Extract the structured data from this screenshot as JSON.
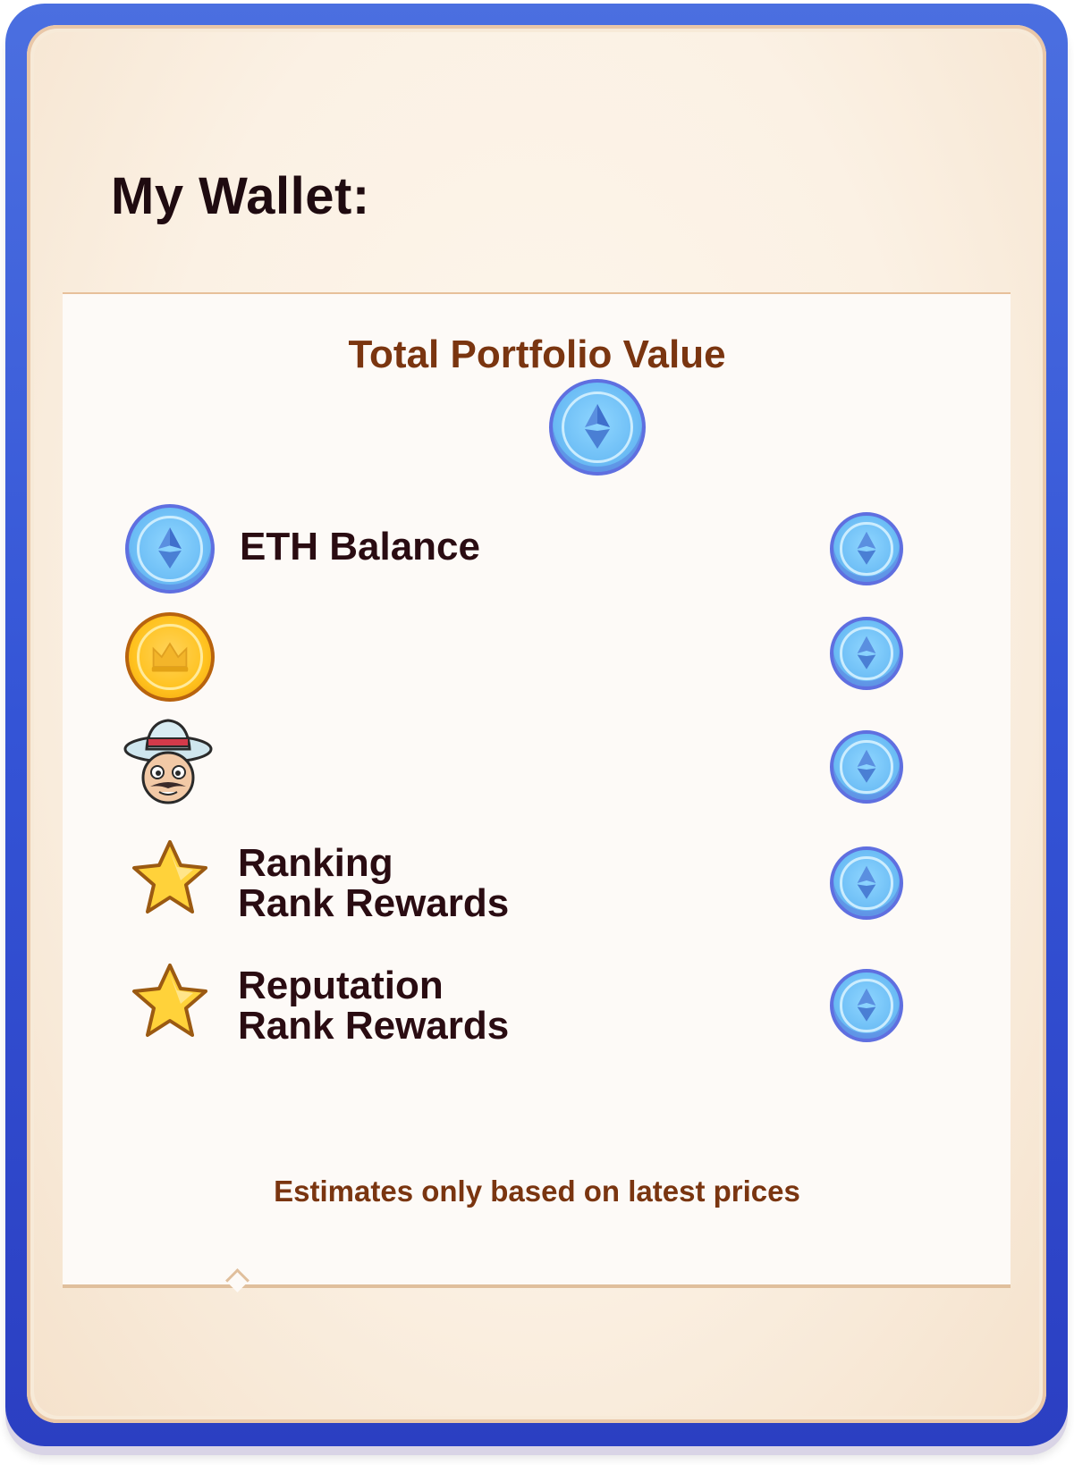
{
  "wallet": {
    "title": "My Wallet:",
    "portfolio_heading": "Total Portfolio Value",
    "portfolio_icon": "eth-coin-icon",
    "rows": [
      {
        "icon": "eth-coin-icon",
        "label": "ETH Balance",
        "value_icon": "eth-coin-icon"
      },
      {
        "icon": "gold-crown-coin-icon",
        "label": "",
        "value_icon": "eth-coin-icon"
      },
      {
        "icon": "character-avatar-icon",
        "label": "",
        "value_icon": "eth-coin-icon"
      },
      {
        "icon": "star-icon",
        "label_line1": "Ranking",
        "label_line2": "Rank Rewards",
        "value_icon": "eth-coin-icon"
      },
      {
        "icon": "star-icon",
        "label_line1": "Reputation",
        "label_line2": "Rank Rewards",
        "value_icon": "eth-coin-icon"
      }
    ],
    "footnote": "Estimates only based on latest prices"
  },
  "colors": {
    "frame_blue": "#3454d6",
    "parchment": "#fbf1e4",
    "heading_brown": "#7a3510",
    "text_dark": "#2a0c12"
  }
}
